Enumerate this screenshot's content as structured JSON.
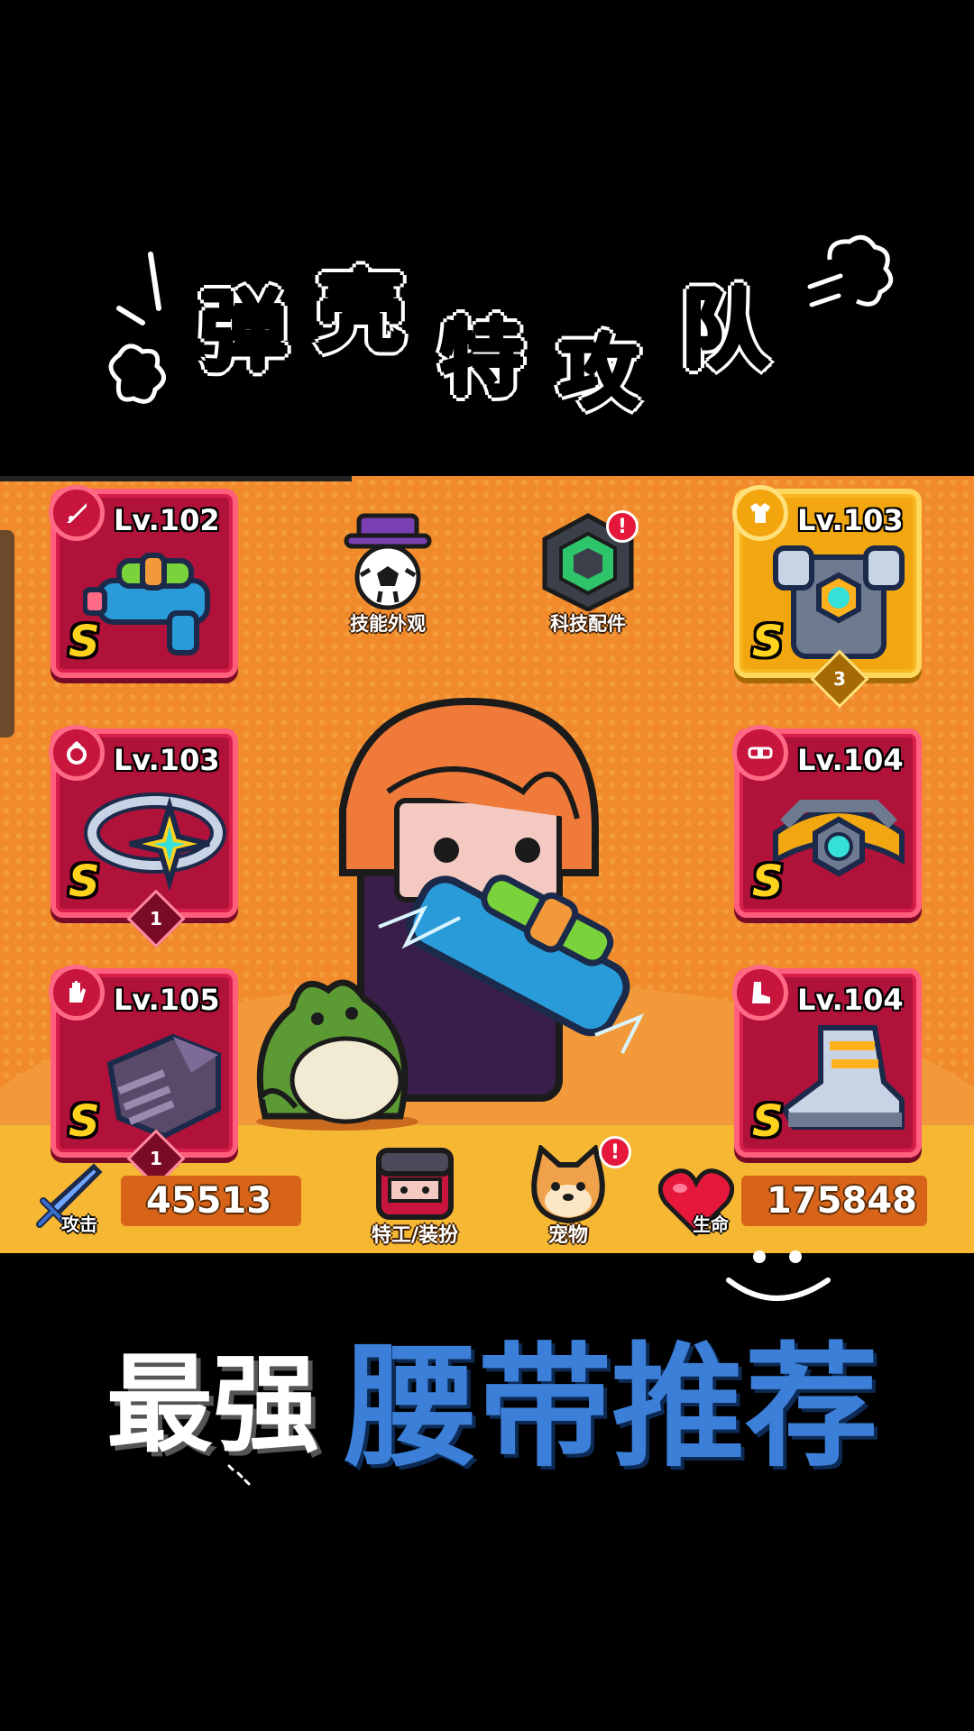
{
  "title": {
    "chars": [
      "弹",
      "壳",
      "特",
      "攻",
      "队"
    ]
  },
  "slots": {
    "weapon": {
      "level": "Lv.102",
      "grade": "S"
    },
    "armor": {
      "level": "Lv.103",
      "grade": "S",
      "count": "3"
    },
    "ring": {
      "level": "Lv.103",
      "grade": "S",
      "count": "1"
    },
    "belt": {
      "level": "Lv.104",
      "grade": "S"
    },
    "gloves": {
      "level": "Lv.105",
      "grade": "S",
      "count": "1"
    },
    "boots": {
      "level": "Lv.104",
      "grade": "S"
    }
  },
  "top_buttons": {
    "skin": {
      "label": "技能外观"
    },
    "tech": {
      "label": "科技配件",
      "alert": "!"
    }
  },
  "bottom": {
    "attack": {
      "label": "攻击",
      "value": "45513"
    },
    "agent": {
      "label": "特工/装扮"
    },
    "pet": {
      "label": "宠物",
      "alert": "!"
    },
    "hp": {
      "label": "生命",
      "value": "175848"
    }
  },
  "caption": {
    "white": "最强",
    "blue": "腰带推荐"
  },
  "colors": {
    "background": "#000000",
    "game_bg": "#f08a2b",
    "slot_red": "#b0123a",
    "slot_gold": "#f2a60f",
    "caption_blue": "#3b7fd9"
  }
}
